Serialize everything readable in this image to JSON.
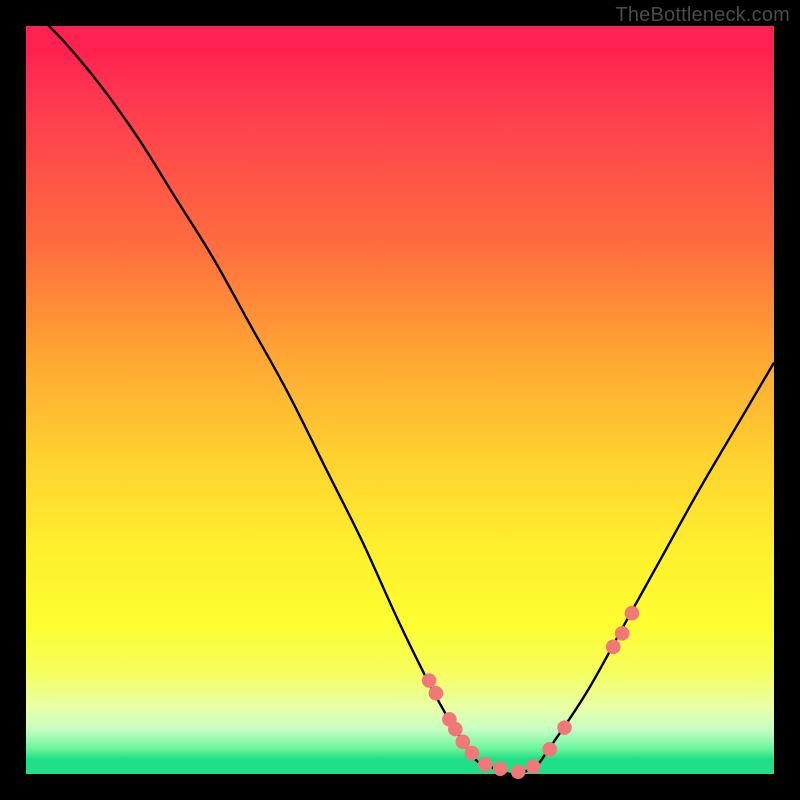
{
  "watermark": "TheBottleneck.com",
  "colors": {
    "background": "#000000",
    "curve": "#000000",
    "dot_fill": "#f07878",
    "dot_stroke": "#d86060",
    "gradient_top": "#ff2150",
    "gradient_bottom": "#1fe086"
  },
  "chart_data": {
    "type": "line",
    "title": "",
    "xlabel": "",
    "ylabel": "",
    "xlim": [
      0,
      100
    ],
    "ylim": [
      0,
      100
    ],
    "series": [
      {
        "name": "bottleneck-curve",
        "x": [
          0,
          5,
          10,
          15,
          20,
          25,
          30,
          35,
          40,
          45,
          50,
          55,
          58,
          60,
          62,
          65,
          68,
          70,
          75,
          80,
          85,
          90,
          95,
          100
        ],
        "y": [
          103,
          98,
          92,
          85,
          77,
          69,
          60,
          51,
          41,
          31,
          20,
          10,
          5,
          2,
          1,
          0,
          1,
          3.5,
          11,
          20,
          29,
          38,
          46.5,
          55
        ]
      }
    ],
    "dots": {
      "name": "highlighted-points",
      "x": [
        53.9,
        54.8,
        56.6,
        57.4,
        58.4,
        59.6,
        61.4,
        63.4,
        65.8,
        67.8,
        70.0,
        72.0,
        78.5,
        79.7,
        81.0
      ],
      "y": [
        12.5,
        10.8,
        7.3,
        6.0,
        4.3,
        2.8,
        1.3,
        0.7,
        0.3,
        1.0,
        3.3,
        6.2,
        17.0,
        18.8,
        21.5
      ]
    }
  }
}
